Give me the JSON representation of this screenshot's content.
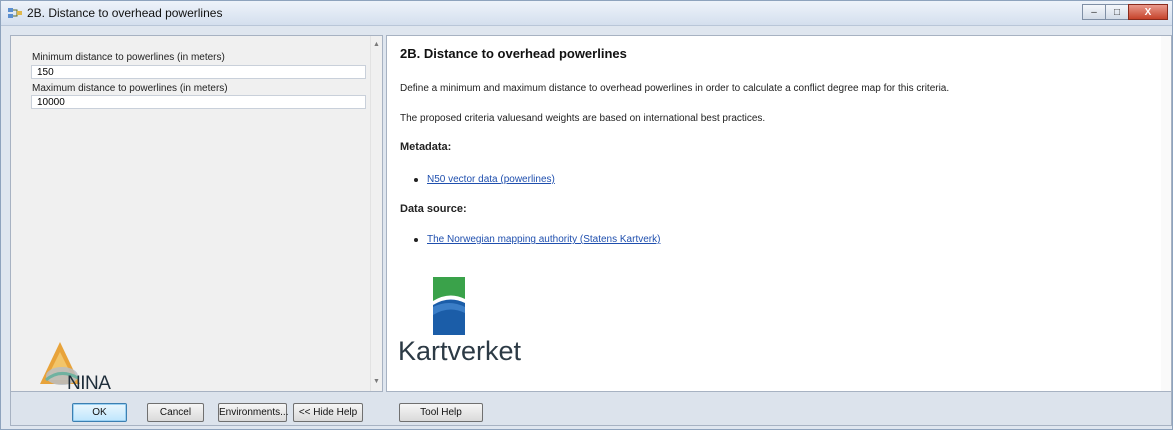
{
  "window": {
    "title": "2B. Distance to overhead powerlines",
    "controls": {
      "minimize": "–",
      "maximize": "□",
      "close": "X"
    }
  },
  "parameters": [
    {
      "label": "Minimum distance to powerlines (in meters)",
      "value": "150"
    },
    {
      "label": "Maximum distance to powerlines (in meters)",
      "value": "10000"
    }
  ],
  "left_logo": {
    "text": "NINA"
  },
  "help": {
    "title": "2B. Distance to overhead powerlines",
    "intro": "Define a minimum and maximum distance to overhead powerlines in order to calculate a conflict degree map for this criteria.",
    "note": "The proposed criteria valuesand weights are based on international best practices.",
    "metadata_heading": "Metadata:",
    "metadata_link": "N50 vector data (powerlines)",
    "source_heading": "Data source:",
    "source_link": "The Norwegian mapping authority (Statens Kartverk)",
    "logo_text": "Kartverket"
  },
  "buttons": {
    "ok": "OK",
    "cancel": "Cancel",
    "environments": "Environments...",
    "hide_help": "<< Hide Help",
    "tool_help": "Tool Help"
  },
  "colors": {
    "link": "#1f4fae",
    "kartverket_green": "#3aa24a",
    "kartverket_blue": "#1b5da8"
  }
}
